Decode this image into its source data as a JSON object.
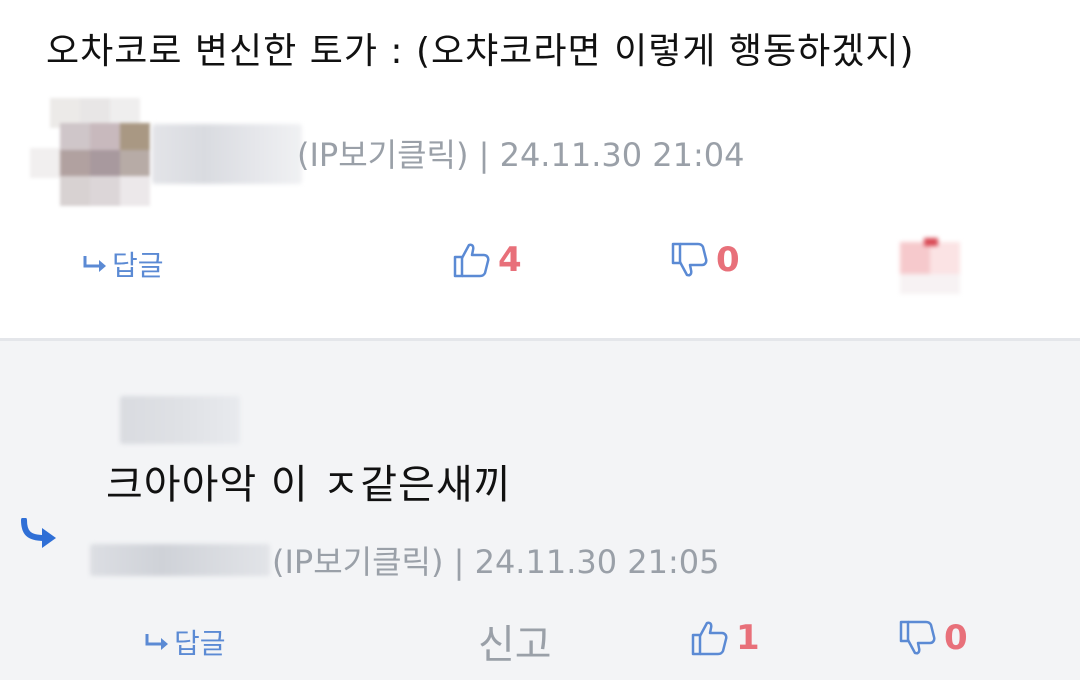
{
  "comment": {
    "text": "오차코로 변신한 토가 : (오챠코라면 이렇게 행동하겠지)",
    "meta": "(IP보기클릭) | 24.11.30 21:04",
    "reply_label": "답글",
    "likes": "4",
    "dislikes": "0"
  },
  "reply": {
    "text": "크아아악 이 ㅈ같은새끼",
    "meta": "(IP보기클릭) | 24.11.30 21:05",
    "reply_label": "답글",
    "report_label": "신고",
    "likes": "1",
    "dislikes": "0"
  },
  "colors": {
    "accent_blue": "#5b8ad4",
    "vote_count": "#e8707a",
    "meta_gray": "#9aa0a8",
    "reply_bg": "#f3f4f6",
    "reply_arrow": "#2f6fd6"
  },
  "icons": {
    "reply_action": "reply-arrow-icon",
    "like": "thumbs-up-icon",
    "dislike": "thumbs-down-icon",
    "reply_indicator": "reply-indicator-icon"
  }
}
